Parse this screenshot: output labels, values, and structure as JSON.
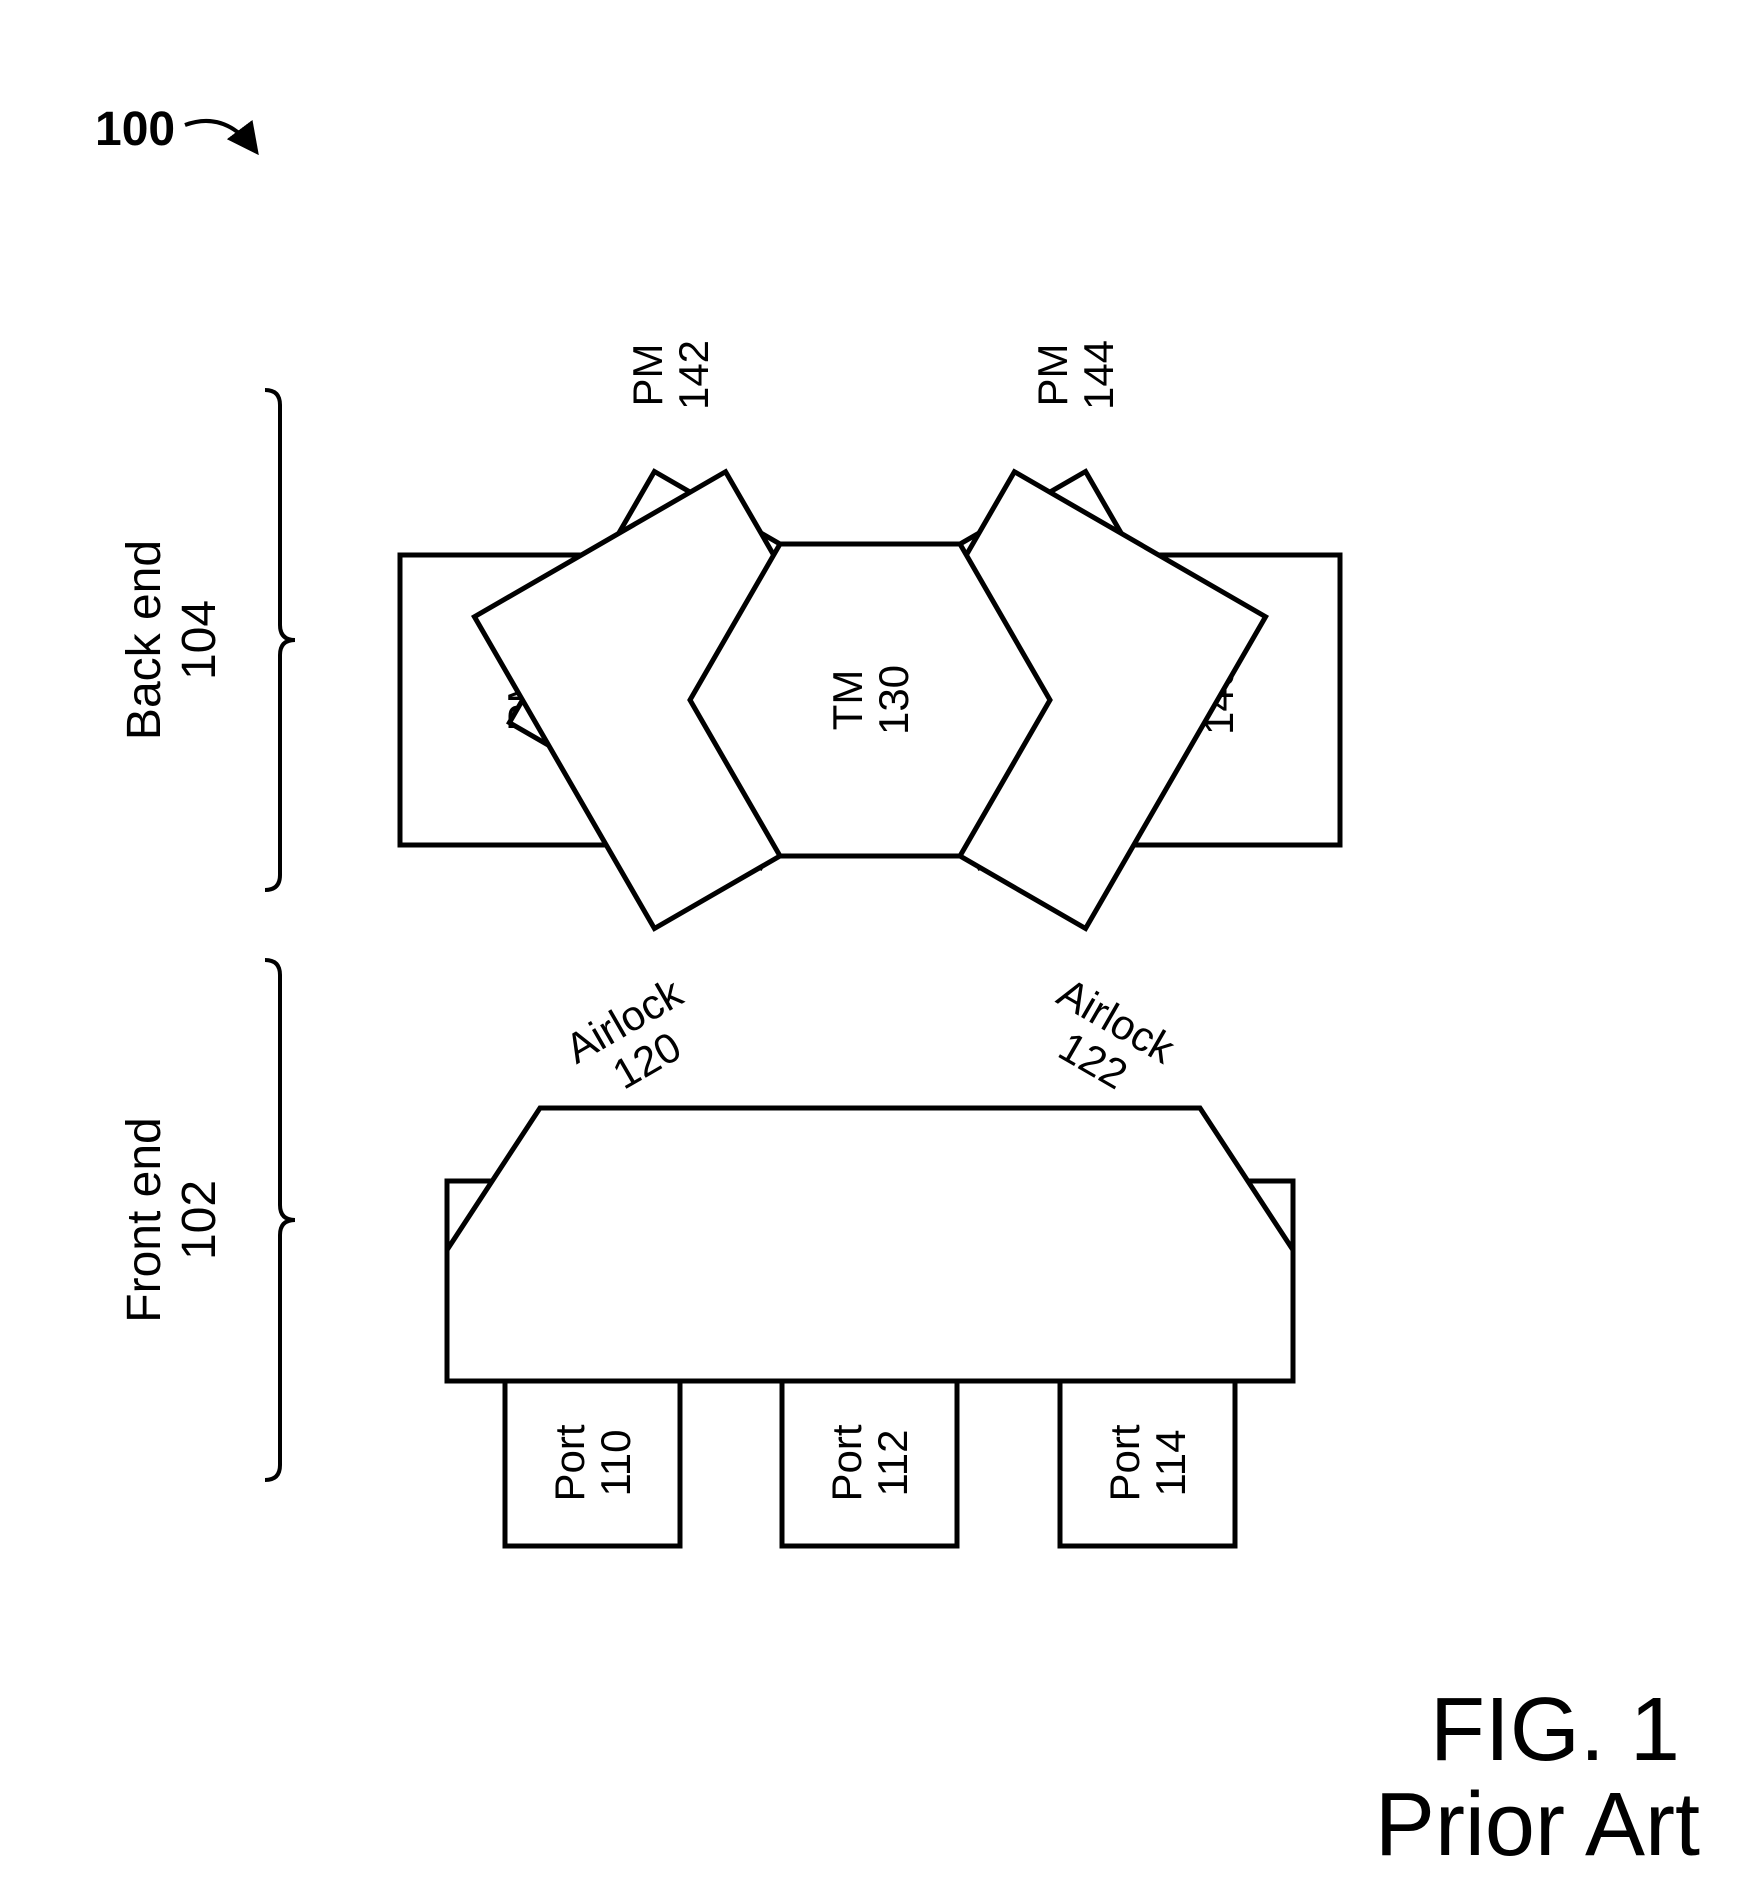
{
  "figure_ref": "100",
  "back_end": {
    "label": "Back end",
    "num": "104"
  },
  "front_end": {
    "label": "Front end",
    "num": "102"
  },
  "tm": {
    "label": "TM",
    "num": "130"
  },
  "pm": [
    {
      "label": "PM",
      "num": "140"
    },
    {
      "label": "PM",
      "num": "142"
    },
    {
      "label": "PM",
      "num": "144"
    },
    {
      "label": "PM",
      "num": "146"
    }
  ],
  "airlock": [
    {
      "label": "Airlock",
      "num": "120"
    },
    {
      "label": "Airlock",
      "num": "122"
    }
  ],
  "port": [
    {
      "label": "Port",
      "num": "110"
    },
    {
      "label": "Port",
      "num": "112"
    },
    {
      "label": "Port",
      "num": "114"
    }
  ],
  "caption": {
    "line1": "FIG. 1",
    "line2": "Prior Art"
  }
}
